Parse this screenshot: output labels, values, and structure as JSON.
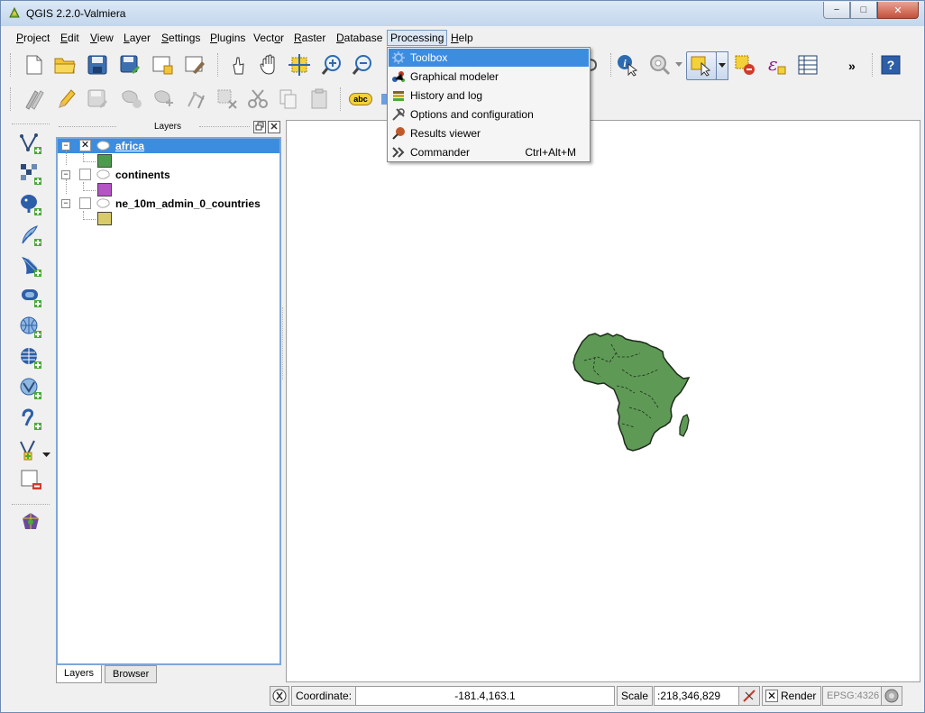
{
  "window": {
    "title": "QGIS 2.2.0-Valmiera",
    "minimize": "−",
    "maximize": "□",
    "close": "✕"
  },
  "menu": [
    {
      "label": "Project",
      "accel": "P",
      "rest": "roject"
    },
    {
      "label": "Edit",
      "accel": "E",
      "rest": "dit"
    },
    {
      "label": "View",
      "accel": "V",
      "rest": "iew"
    },
    {
      "label": "Layer",
      "accel": "L",
      "rest": "ayer"
    },
    {
      "label": "Settings",
      "accel": "S",
      "rest": "ettings"
    },
    {
      "label": "Plugins",
      "accel": "P",
      "rest": "lugins"
    },
    {
      "label": "Vector",
      "accel": "o",
      "pre": "Vect",
      "rest": "r"
    },
    {
      "label": "Raster",
      "accel": "R",
      "rest": "aster"
    },
    {
      "label": "Database",
      "accel": "D",
      "rest": "atabase"
    },
    {
      "label": "Processing",
      "accel": "",
      "rest": "Processing"
    },
    {
      "label": "Help",
      "accel": "H",
      "rest": "elp"
    }
  ],
  "processing_menu": [
    {
      "label": "Toolbox",
      "shortcut": "",
      "icon": "gear-icon",
      "highlighted": true
    },
    {
      "label": "Graphical modeler",
      "shortcut": "",
      "icon": "model-icon",
      "highlighted": false
    },
    {
      "label": "History and log",
      "shortcut": "",
      "icon": "history-icon",
      "highlighted": false
    },
    {
      "label": "Options and configuration",
      "shortcut": "",
      "icon": "wrench-icon",
      "highlighted": false
    },
    {
      "label": "Results viewer",
      "shortcut": "",
      "icon": "results-icon",
      "highlighted": false
    },
    {
      "label": "Commander",
      "shortcut": "Ctrl+Alt+M",
      "icon": "commander-icon",
      "highlighted": false
    }
  ],
  "layers_panel": {
    "title": "Layers",
    "layers": [
      {
        "name": "africa",
        "checked": true,
        "selected": true,
        "color": "#4e9a4e"
      },
      {
        "name": "continents",
        "checked": false,
        "selected": false,
        "color": "#b554c4"
      },
      {
        "name": "ne_10m_admin_0_countries",
        "checked": false,
        "selected": false,
        "color": "#d8cc6a"
      }
    ],
    "tabs": [
      "Layers",
      "Browser"
    ],
    "active_tab": "Layers"
  },
  "statusbar": {
    "coordinate_label": "Coordinate:",
    "coordinate_value": "-181.4,163.1",
    "scale_label": "Scale",
    "scale_value": ":218,346,829",
    "render_label": "Render",
    "render_checked": true,
    "crs": "EPSG:4326"
  },
  "toolbar_overflow": "»",
  "label_tool": "abc",
  "map": {
    "land_color": "#5e9a56",
    "outline_color": "#1e2a1a"
  }
}
